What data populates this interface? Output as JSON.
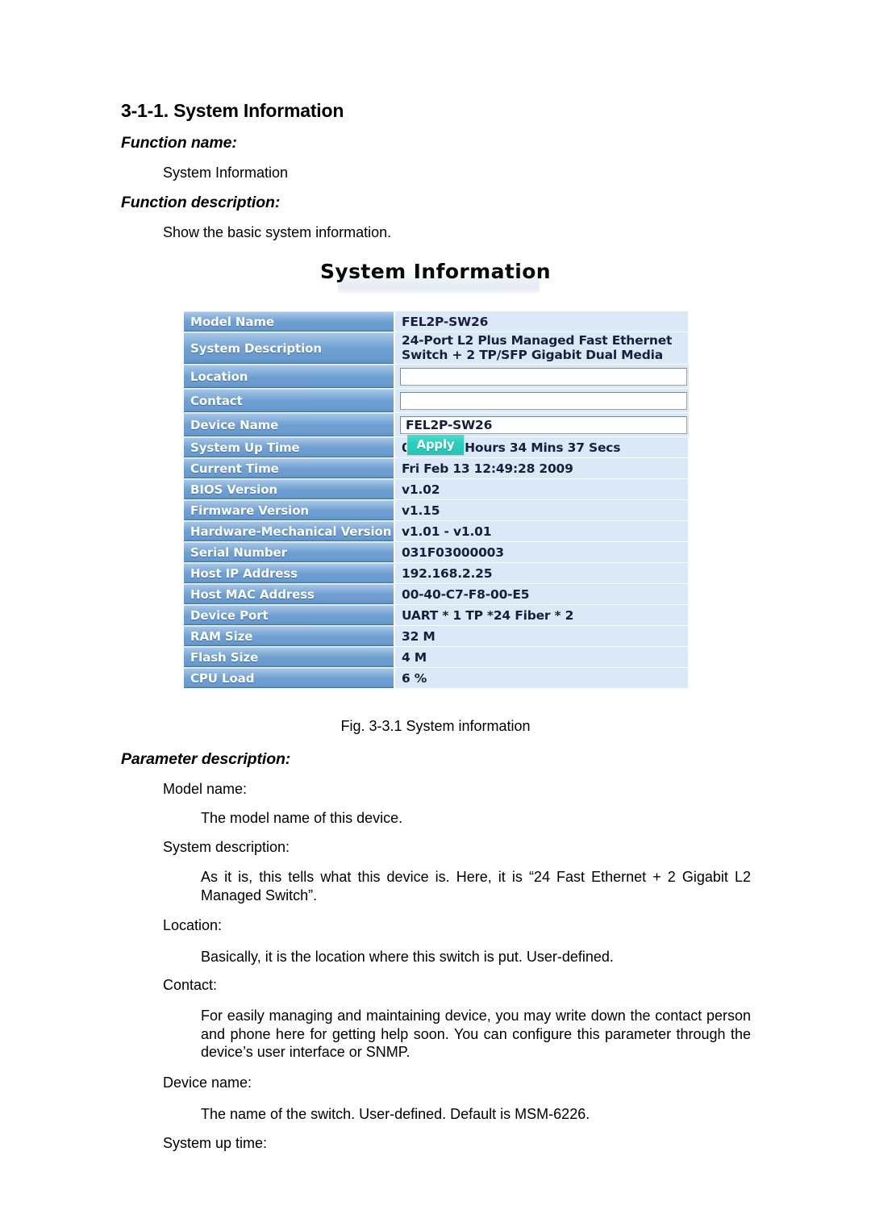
{
  "document": {
    "section_number_title": "3-1-1. System Information",
    "headings": {
      "function_name": "Function name:",
      "function_description": "Function description:",
      "parameter_description": "Parameter description:"
    },
    "function_name_value": "System Information",
    "function_description_value": "Show the basic system information.",
    "figure_caption": "Fig. 3-3.1 System information",
    "parameters": [
      {
        "term": "Model name:",
        "text": "The model name of this device."
      },
      {
        "term": "System description:",
        "text": "As it is, this tells what this device is. Here, it is “24 Fast Ethernet + 2 Gigabit L2  Managed Switch”."
      },
      {
        "term": "Location:",
        "text": "Basically, it is the location where this switch is put. User-defined."
      },
      {
        "term": "Contact:",
        "text": "For easily managing and maintaining device, you may write down the contact person and phone here for getting help soon. You can configure this parameter through the device’s user interface or SNMP."
      },
      {
        "term": "Device name:",
        "text": "The name of the switch. User-defined. Default is  MSM-6226."
      },
      {
        "term": "System up time:",
        "text": ""
      }
    ]
  },
  "screenshot": {
    "title": "System Information",
    "apply_button_label": "Apply",
    "rows": [
      {
        "label": "Model Name",
        "value": "FEL2P-SW26",
        "kind": "text"
      },
      {
        "label": "System Description",
        "value": "24-Port L2 Plus Managed Fast Ethernet\nSwitch + 2 TP/SFP Gigabit Dual Media",
        "kind": "text2"
      },
      {
        "label": "Location",
        "value": "",
        "kind": "input"
      },
      {
        "label": "Contact",
        "value": "",
        "kind": "input"
      },
      {
        "label": "Device Name",
        "value": "FEL2P-SW26",
        "kind": "input"
      },
      {
        "label": "System Up Time",
        "value": "0 Days 4 Hours 34 Mins 37 Secs",
        "kind": "text"
      },
      {
        "label": "Current Time",
        "value": "Fri Feb 13 12:49:28 2009",
        "kind": "text"
      },
      {
        "label": "BIOS Version",
        "value": "v1.02",
        "kind": "text"
      },
      {
        "label": "Firmware Version",
        "value": "v1.15",
        "kind": "text"
      },
      {
        "label": "Hardware-Mechanical Version",
        "value": "v1.01 - v1.01",
        "kind": "text"
      },
      {
        "label": "Serial Number",
        "value": "031F03000003",
        "kind": "text"
      },
      {
        "label": "Host IP Address",
        "value": "192.168.2.25",
        "kind": "text"
      },
      {
        "label": "Host MAC Address",
        "value": "00-40-C7-F8-00-E5",
        "kind": "text"
      },
      {
        "label": "Device Port",
        "value": "UART * 1 TP *24 Fiber * 2",
        "kind": "text"
      },
      {
        "label": "RAM Size",
        "value": "32 M",
        "kind": "text"
      },
      {
        "label": "Flash Size",
        "value": "4 M",
        "kind": "text"
      },
      {
        "label": "CPU Load",
        "value": "6 %",
        "kind": "text"
      }
    ]
  },
  "colors": {
    "label_blue": "#6e9fd2",
    "value_bg": "#dbe9f7",
    "apply_teal": "#2ecfbe",
    "text_dark": "#14213d"
  }
}
